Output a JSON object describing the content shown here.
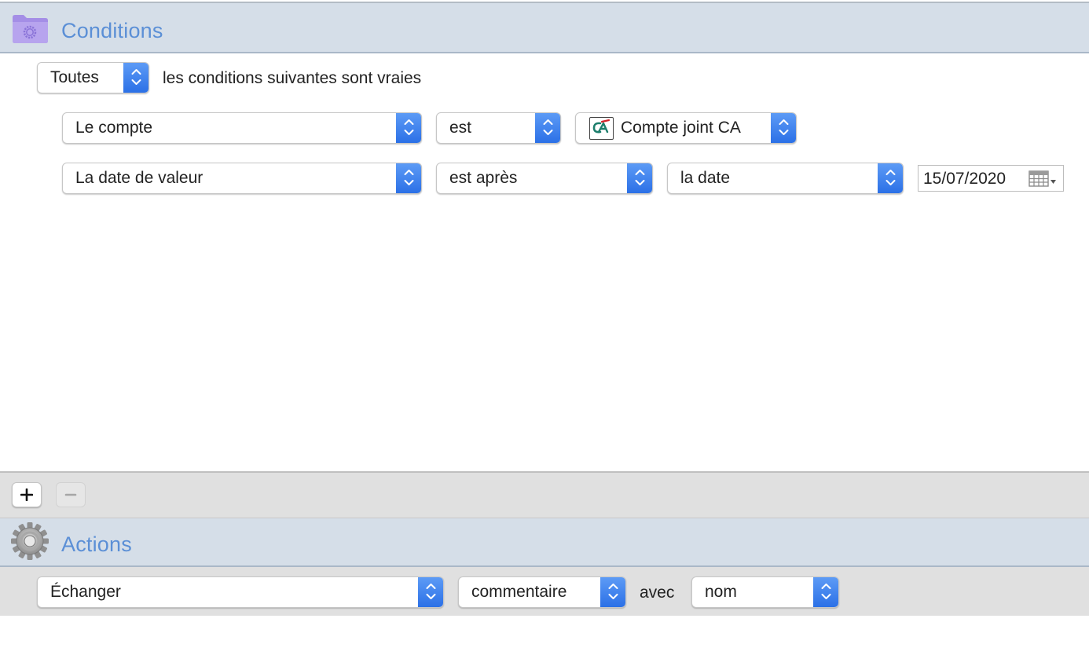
{
  "conditions": {
    "title": "Conditions",
    "icon": "gear-folder-icon",
    "match_mode": {
      "value": "Toutes",
      "suffix": "les conditions suivantes sont vraies"
    },
    "rows": [
      {
        "field": "Le compte",
        "operator": "est",
        "value": "Compte joint CA",
        "value_icon": "credit-agricole-logo"
      },
      {
        "field": "La date de valeur",
        "operator": "est après",
        "value": "la date",
        "date": "15/07/2020",
        "date_icon": "calendar-grid-icon"
      }
    ]
  },
  "toolbar": {
    "add_icon": "plus-icon",
    "remove_icon": "minus-icon"
  },
  "actions": {
    "title": "Actions",
    "icon": "gear-icon",
    "row": {
      "action": "Échanger",
      "field": "commentaire",
      "connector": "avec",
      "target": "nom"
    }
  },
  "colors": {
    "header_bg": "#d5dee8",
    "header_title": "#5b8fd6",
    "popup_accent": "#2a6fe6",
    "bar_bg": "#e0e0e0"
  }
}
